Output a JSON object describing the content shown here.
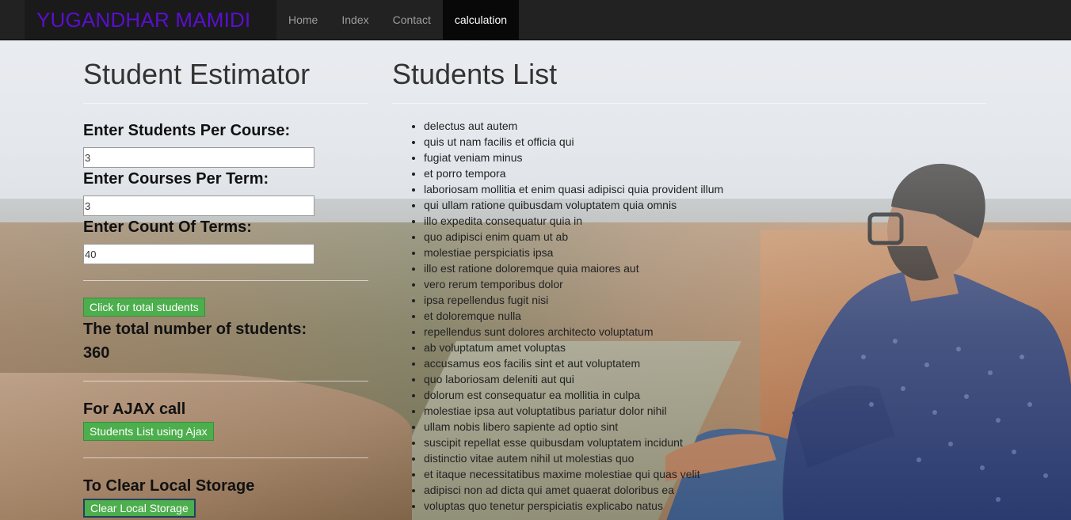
{
  "navbar": {
    "brand": "YUGANDHAR MAMIDI",
    "links": [
      "Home",
      "Index",
      "Contact",
      "calculation"
    ],
    "active": "calculation"
  },
  "estimator": {
    "title": "Student Estimator",
    "students_per_course_label": "Enter Students Per Course:",
    "students_per_course_value": "3",
    "courses_per_term_label": "Enter Courses Per Term:",
    "courses_per_term_value": "3",
    "count_of_terms_label": "Enter Count Of Terms:",
    "count_of_terms_value": "40",
    "total_button": "Click for total students",
    "total_label": "The total number of students:",
    "total_value": "360",
    "ajax_label": "For AJAX call",
    "ajax_button": "Students List using Ajax",
    "clear_label": "To Clear Local Storage",
    "clear_button": "Clear Local Storage"
  },
  "students_list": {
    "title": "Students List",
    "items": [
      "delectus aut autem",
      "quis ut nam facilis et officia qui",
      "fugiat veniam minus",
      "et porro tempora",
      "laboriosam mollitia et enim quasi adipisci quia provident illum",
      "qui ullam ratione quibusdam voluptatem quia omnis",
      "illo expedita consequatur quia in",
      "quo adipisci enim quam ut ab",
      "molestiae perspiciatis ipsa",
      "illo est ratione doloremque quia maiores aut",
      "vero rerum temporibus dolor",
      "ipsa repellendus fugit nisi",
      "et doloremque nulla",
      "repellendus sunt dolores architecto voluptatum",
      "ab voluptatum amet voluptas",
      "accusamus eos facilis sint et aut voluptatem",
      "quo laboriosam deleniti aut qui",
      "dolorum est consequatur ea mollitia in culpa",
      "molestiae ipsa aut voluptatibus pariatur dolor nihil",
      "ullam nobis libero sapiente ad optio sint",
      "suscipit repellat esse quibusdam voluptatem incidunt",
      "distinctio vitae autem nihil ut molestias quo",
      "et itaque necessitatibus maxime molestiae qui quas velit",
      "adipisci non ad dicta qui amet quaerat doloribus ea",
      "voluptas quo tenetur perspiciatis explicabo natus"
    ]
  },
  "colors": {
    "navbar": "#222222",
    "brand_text": "#5a0fcf",
    "button_green": "#4cae4c"
  }
}
